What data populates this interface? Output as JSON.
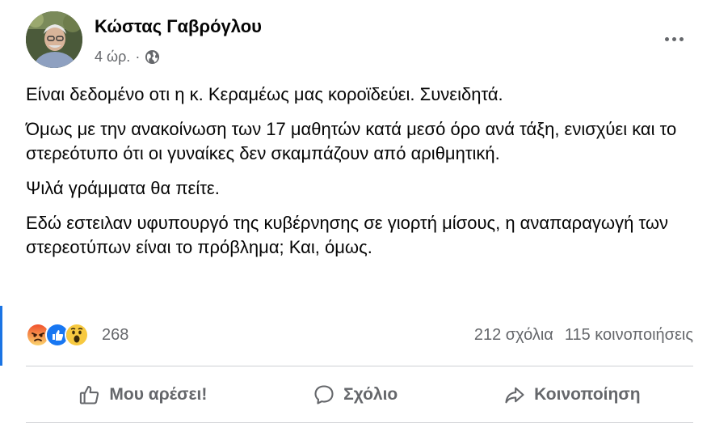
{
  "post": {
    "author": "Κώστας Γαβρόγλου",
    "time": "4 ώρ.",
    "separator": "·",
    "visibility_icon": "globe-icon",
    "paragraphs": [
      "Είναι δεδομένο οτι η κ. Κεραμέως μας κοροϊδεύει. Συνειδητά.",
      "Όμως με την ανακοίνωση των 17 μαθητών κατά μεσό όρο ανά τάξη, ενισχύει και το στερεότυπο ότι οι γυναίκες δεν σκαμπάζουν από αριθμητική.",
      "Ψιλά γράμματα θα πείτε.",
      "Εδώ εστειλαν υφυπουργό της κυβέρνησης σε γιορτή μίσους, η αναπαραγωγή των στερεοτύπων είναι το πρόβλημα; Και, όμως."
    ]
  },
  "stats": {
    "reactions": [
      "angry",
      "like",
      "wow"
    ],
    "reaction_count": "268",
    "comments": "212 σχόλια",
    "shares": "115 κοινοποιήσεις"
  },
  "actions": {
    "like": "Μου αρέσει!",
    "comment": "Σχόλιο",
    "share": "Κοινοποίηση"
  },
  "colors": {
    "accent": "#1b74e4",
    "muted_text": "#65676b",
    "divider": "#ced0d4"
  }
}
